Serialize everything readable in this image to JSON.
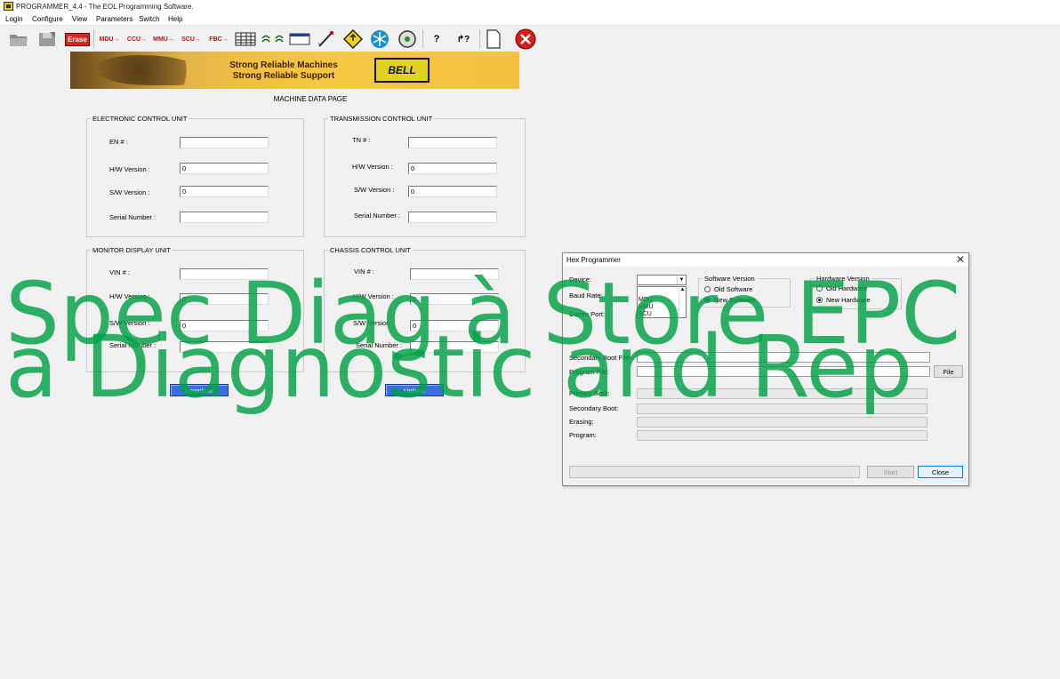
{
  "window": {
    "title": "PROGRAMMER_4.4 - The EOL Programming Software."
  },
  "menu": [
    "Login",
    "Configure",
    "View",
    "Parameters",
    "Switch",
    "Help"
  ],
  "toolbar": {
    "erase": "Erase",
    "mdu": "MDU→",
    "ccu": "CCU→",
    "mmu": "MMU→",
    "scu": "SCU→",
    "fbc": "FBC→",
    "icons": [
      "open-folder-icon",
      "save-icon",
      "erase-icon",
      "mdu-arrow-icon",
      "ccu-arrow-icon",
      "mmu-arrow-icon",
      "scu-arrow-icon",
      "fbc-arrow-icon",
      "table-grid-icon",
      "signal-icon",
      "wave-icon",
      "window-icon",
      "pen-icon",
      "warning-diamond-icon",
      "snowflake-icon",
      "disc-icon",
      "help-icon",
      "context-help-icon",
      "document-icon",
      "close-red-icon"
    ]
  },
  "banner": {
    "line1": "Strong Reliable Machines",
    "line2": "Strong Reliable Support",
    "logo": "BELL"
  },
  "page": {
    "heading": "MACHINE DATA PAGE"
  },
  "ecu": {
    "title": "ELECTRONIC CONTROL UNIT",
    "fields": [
      {
        "label": "EN # :",
        "value": ""
      },
      {
        "label": "H/W Version :",
        "value": "0"
      },
      {
        "label": "S/W Version :",
        "value": "0"
      },
      {
        "label": "Serial Number :",
        "value": ""
      }
    ]
  },
  "tcu": {
    "title": "TRANSMISSION CONTROL UNIT",
    "fields": [
      {
        "label": "TN # :",
        "value": ""
      },
      {
        "label": "H/W Version :",
        "value": "0"
      },
      {
        "label": "S/W Version :",
        "value": "0"
      },
      {
        "label": "Serial Number :",
        "value": ""
      }
    ]
  },
  "mdu": {
    "title": "MONITOR DISPLAY UNIT",
    "fields": [
      {
        "label": "VIN # :",
        "value": ""
      },
      {
        "label": "H/W Version :",
        "value": "0"
      },
      {
        "label": "S/W Version :",
        "value": "0"
      },
      {
        "label": "Serial Number :",
        "value": ""
      }
    ]
  },
  "ccu": {
    "title": "CHASSIS CONTROL UNIT",
    "fields": [
      {
        "label": "VIN # :",
        "value": ""
      },
      {
        "label": "H/W Version :",
        "value": "0"
      },
      {
        "label": "S/W Version :",
        "value": "0"
      },
      {
        "label": "Serial Number :",
        "value": ""
      }
    ]
  },
  "buttons": {
    "download": "Download",
    "upload": "Upload"
  },
  "hex": {
    "title": "Hex Programmer",
    "device_label": "Device:",
    "baud_label": "Baud Rate:",
    "comm_label": "Comm Port:",
    "device_options": [
      "MDU",
      "MMU",
      "SCU"
    ],
    "software_version": {
      "title": "Software Version",
      "old": "Old Software",
      "new": "New Software",
      "selected": "new"
    },
    "hardware_version": {
      "title": "Hardware Version",
      "old": "Old Hardware",
      "new": "New Hardware",
      "selected": "new"
    },
    "secondary_boot_file_label": "Secondary Boot File:",
    "program_file_label": "Program File:",
    "file_button": "File",
    "primary_boot_label": "Primary Boot:",
    "secondary_boot_label": "Secondary Boot:",
    "erasing_label": "Erasing:",
    "program_label": "Program:",
    "start_button": "Start",
    "close_button": "Close"
  },
  "watermark": {
    "line1": "Spec Diag à Store EPC",
    "line2": "a Diagnostic and Rep"
  }
}
